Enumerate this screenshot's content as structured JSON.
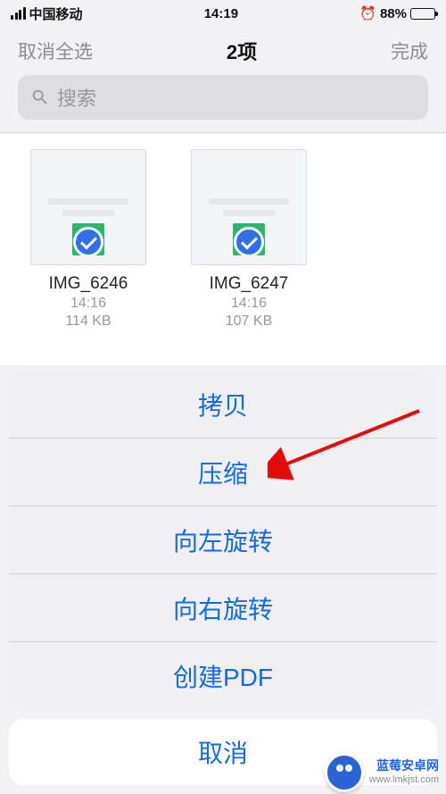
{
  "status": {
    "carrier": "中国移动",
    "time": "14:19",
    "battery_pct": "88%"
  },
  "nav": {
    "left": "取消全选",
    "title": "2项",
    "right": "完成"
  },
  "search": {
    "placeholder": "搜索"
  },
  "files": [
    {
      "name": "IMG_6246",
      "time": "14:16",
      "size": "114 KB"
    },
    {
      "name": "IMG_6247",
      "time": "14:16",
      "size": "107 KB"
    }
  ],
  "sheet": {
    "actions": [
      "拷贝",
      "压缩",
      "向左旋转",
      "向右旋转",
      "创建PDF"
    ],
    "cancel": "取消"
  },
  "watermark": {
    "title": "蓝莓安卓网",
    "url": "www.lmkjst.com"
  }
}
